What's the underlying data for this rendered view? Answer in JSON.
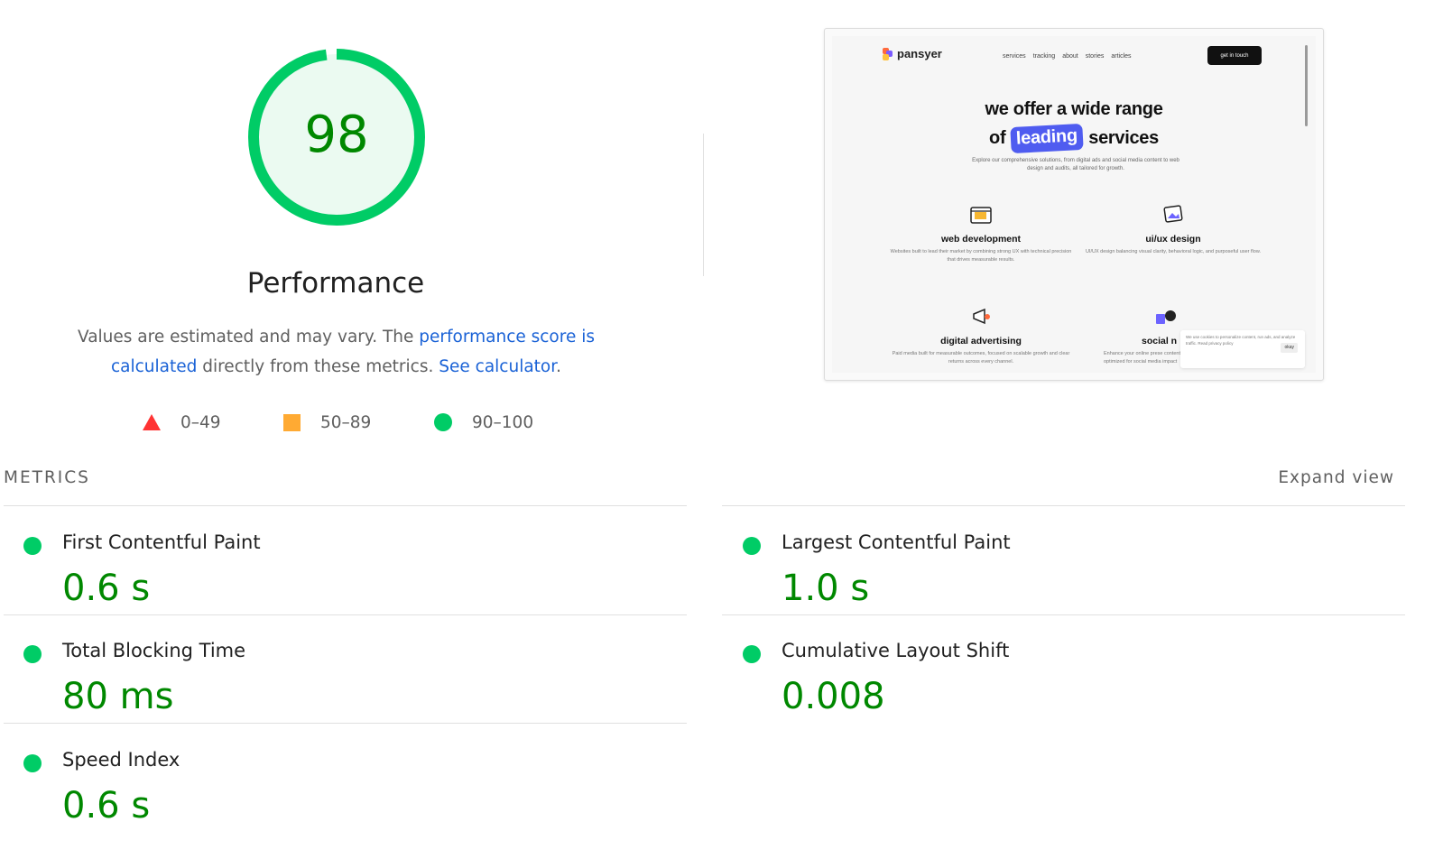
{
  "score": {
    "value": 98,
    "fraction": 0.98,
    "title": "Performance",
    "description": {
      "text1": "Values are estimated and may vary. The ",
      "link1": "performance score is calculated",
      "text2": " directly from these metrics. ",
      "link2": "See calculator",
      "text3": "."
    }
  },
  "legend": [
    {
      "shape": "triangle",
      "label": "0–49",
      "color": "#ff3333"
    },
    {
      "shape": "square",
      "label": "50–89",
      "color": "#ffaa33"
    },
    {
      "shape": "circle",
      "label": "90–100",
      "color": "#00cc66"
    }
  ],
  "screenshot": {
    "brand": "pansyer",
    "nav": [
      "services",
      "tracking",
      "about",
      "stories",
      "articles"
    ],
    "cta": "get in touch",
    "hero_line1": "we offer a wide range",
    "hero_line2_pre": "of",
    "hero_line2_pill": "leading",
    "hero_line2_post": "services",
    "hero_sub": "Explore our comprehensive solutions, from digital ads and social media content to web design and audits, all tailored for growth.",
    "services": [
      {
        "name": "web development",
        "blurb": "Websites built to lead their market by combining strong UX with technical precision that drives measurable results."
      },
      {
        "name": "ui/ux design",
        "blurb": "UI/UX design balancing visual clarity, behavioral logic, and purposeful user flow."
      },
      {
        "name": "digital advertising",
        "blurb": "Paid media built for measurable outcomes, focused on scalable growth and clear returns across every channel."
      },
      {
        "name": "social n",
        "blurb": "Enhance your online prese content optimized for social media impact"
      }
    ],
    "cookie_text": "We use cookies to personalize content, run ads, and analyze traffic. Read privacy policy",
    "cookie_button": "okay"
  },
  "metrics_header": {
    "label": "METRICS",
    "expand": "Expand view"
  },
  "metrics": [
    {
      "name": "First Contentful Paint",
      "value": "0.6 s"
    },
    {
      "name": "Largest Contentful Paint",
      "value": "1.0 s"
    },
    {
      "name": "Total Blocking Time",
      "value": "80 ms"
    },
    {
      "name": "Cumulative Layout Shift",
      "value": "0.008"
    },
    {
      "name": "Speed Index",
      "value": "0.6 s"
    }
  ],
  "colors": {
    "pass": "#00cc66",
    "pass_text": "#008800",
    "gauge_fill": "#ebfaf1",
    "link": "#1a62d6"
  }
}
